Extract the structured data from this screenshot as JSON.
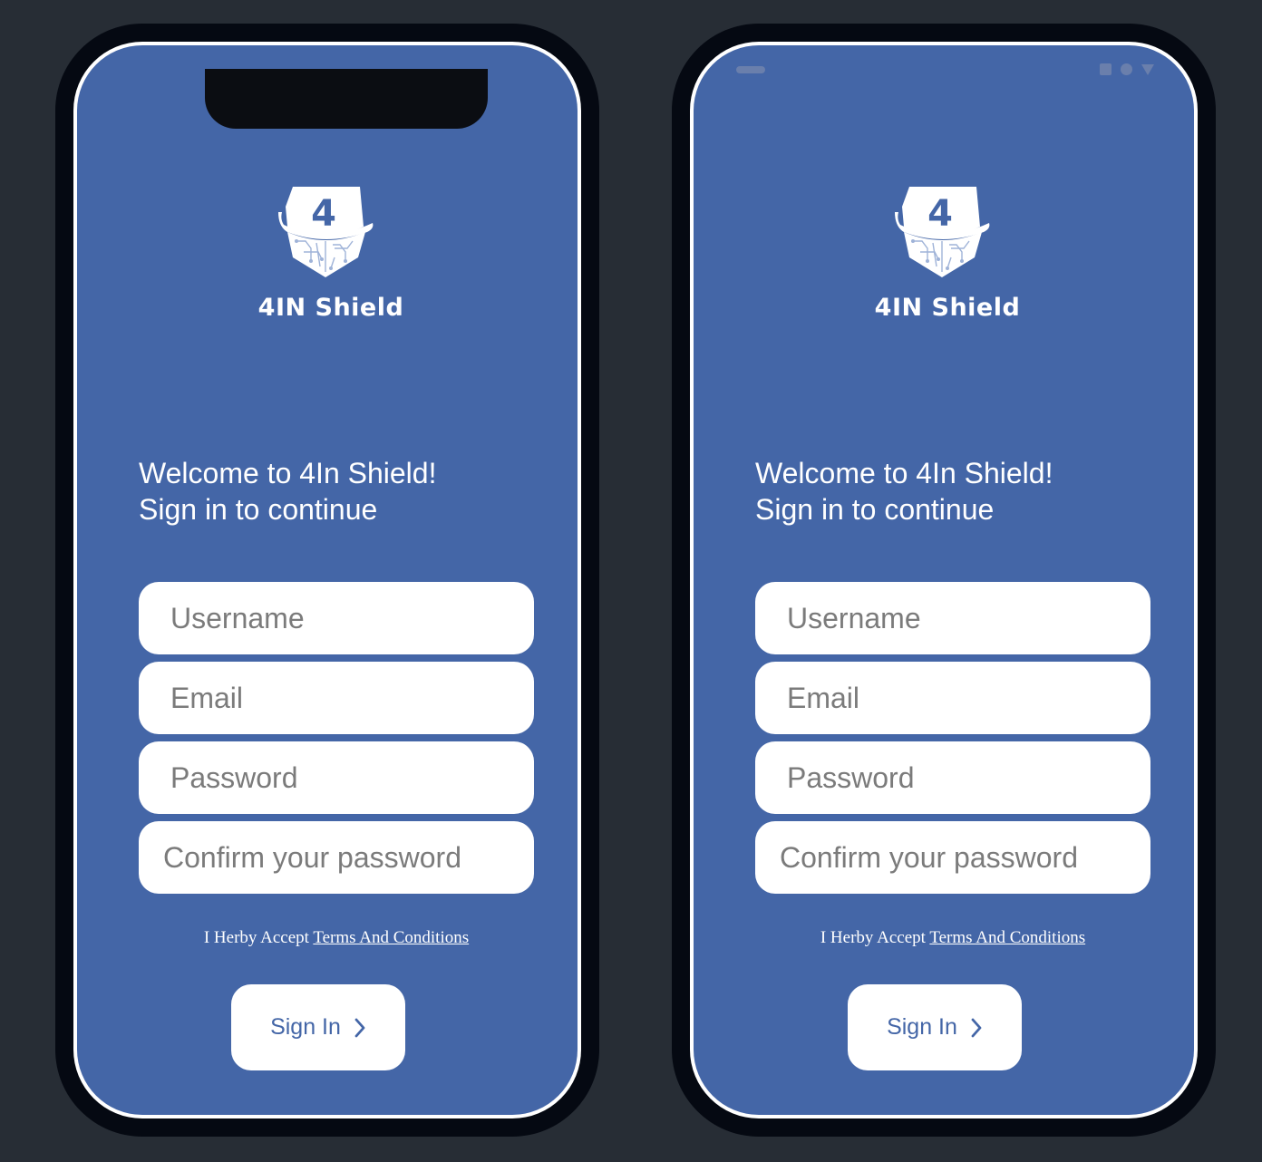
{
  "app": {
    "brand_name": "4IN Shield",
    "logo_digit": "4",
    "welcome_line1": "Welcome to 4In Shield!",
    "welcome_line2": "Sign in to continue"
  },
  "form": {
    "username_placeholder": "Username",
    "email_placeholder": "Email",
    "password_placeholder": "Password",
    "confirm_placeholder": "Confirm your password"
  },
  "terms": {
    "prefix": "I Herby Accept",
    "link_text": "Terms And Conditions"
  },
  "button": {
    "signin_label": "Sign In",
    "signin_icon": "chevron-right-icon"
  },
  "colors": {
    "background": "#272d35",
    "device_frame": "#050912",
    "screen": "#4466a7",
    "field": "#ffffff",
    "placeholder": "#7b7b7b",
    "accent": "#4466a7"
  },
  "devices": [
    {
      "platform": "iOS"
    },
    {
      "platform": "Android"
    }
  ]
}
